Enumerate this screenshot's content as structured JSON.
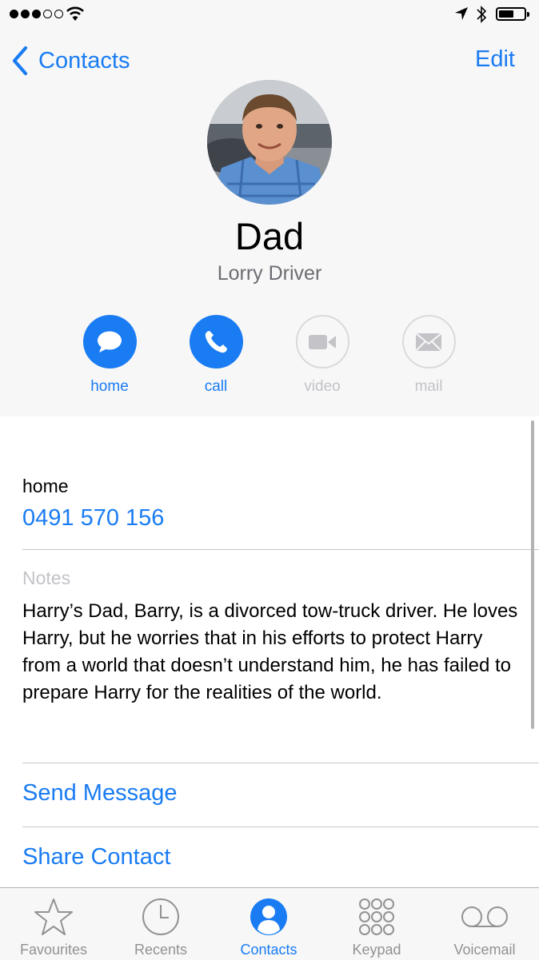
{
  "nav": {
    "back_label": "Contacts",
    "edit_label": "Edit"
  },
  "contact": {
    "name": "Dad",
    "job": "Lorry Driver"
  },
  "actions": [
    {
      "label": "home",
      "icon": "message-icon",
      "enabled": true
    },
    {
      "label": "call",
      "icon": "phone-icon",
      "enabled": true
    },
    {
      "label": "video",
      "icon": "video-icon",
      "enabled": false
    },
    {
      "label": "mail",
      "icon": "mail-icon",
      "enabled": false
    }
  ],
  "phone": {
    "label": "home",
    "number": "0491 570 156"
  },
  "notes": {
    "label": "Notes",
    "text": "Harry’s Dad, Barry, is a divorced tow-truck driver. He loves Harry, but he worries that in his efforts to protect Harry from a world that doesn’t understand him, he has failed to prepare Harry for the realities of the world."
  },
  "row_actions": {
    "send_message": "Send Message",
    "share_contact": "Share Contact"
  },
  "tabs": [
    {
      "label": "Favourites",
      "icon": "star-icon",
      "active": false
    },
    {
      "label": "Recents",
      "icon": "clock-icon",
      "active": false
    },
    {
      "label": "Contacts",
      "icon": "person-icon",
      "active": true
    },
    {
      "label": "Keypad",
      "icon": "keypad-icon",
      "active": false
    },
    {
      "label": "Voicemail",
      "icon": "voicemail-icon",
      "active": false
    }
  ],
  "colors": {
    "accent": "#1a7cf2",
    "disabled": "#c3c3c8",
    "secondary": "#6d6d72"
  }
}
